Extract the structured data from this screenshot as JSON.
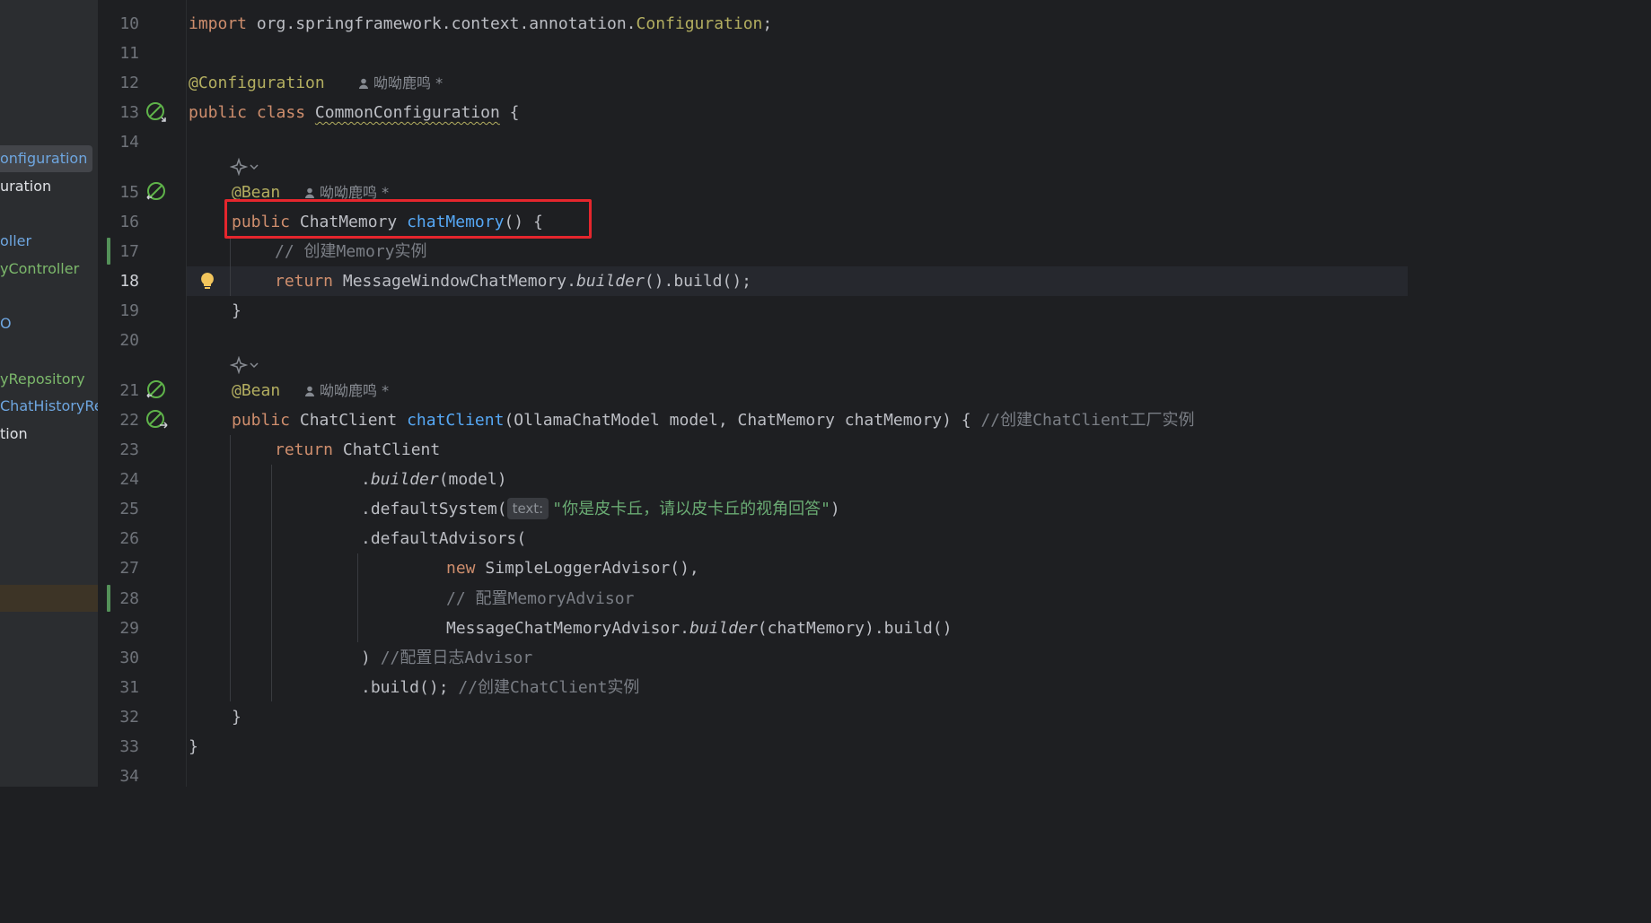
{
  "sidebar": {
    "items": [
      {
        "label": "onfiguration",
        "color": "#6ea6e0",
        "selected": true
      },
      {
        "label": "uration",
        "color": "#dfe1e5"
      },
      {
        "label": "oller",
        "color": "#6ea6e0"
      },
      {
        "label": "yController",
        "color": "#7cb86b"
      },
      {
        "label": "O",
        "color": "#6ea6e0"
      },
      {
        "label": "yRepository",
        "color": "#7cb86b"
      },
      {
        "label": "ChatHistoryRep",
        "color": "#6ea6e0"
      },
      {
        "label": "tion",
        "color": "#dfe1e5"
      }
    ]
  },
  "gutter": {
    "line_numbers": [
      "10",
      "11",
      "12",
      "13",
      "14",
      "15",
      "16",
      "17",
      "18",
      "19",
      "20",
      "21",
      "22",
      "23",
      "24",
      "25",
      "26",
      "27",
      "28",
      "29",
      "30",
      "31",
      "32",
      "33",
      "34"
    ],
    "current_line": "18"
  },
  "code": {
    "l10": {
      "kw": "import",
      "pkg": " org.springframework.context.annotation.",
      "cls": "Configuration",
      ";": ";"
    },
    "l12": {
      "ann": "@Configuration",
      "author": "呦呦鹿鸣 *"
    },
    "l13": {
      "kw": "public class ",
      "name": "CommonConfiguration",
      " ob": " {"
    },
    "l15": {
      "ann": "@Bean",
      "author": "呦呦鹿鸣 *"
    },
    "l16": {
      "kw": "public ",
      "type": "ChatMemory ",
      "fn": "chatMemory",
      "rest": "() {"
    },
    "l17": {
      "comment": "// 创建Memory实例"
    },
    "l18": {
      "kw": "return ",
      "cls": "MessageWindowChatMemory.",
      "it": "builder",
      "rest": "().build();"
    },
    "l19": {
      "text": "}"
    },
    "l21": {
      "ann": "@Bean",
      "author": "呦呦鹿鸣 *"
    },
    "l22": {
      "kw": "public ",
      "type": "ChatClient ",
      "fn": "chatClient",
      "rest": "(OllamaChatModel model, ChatMemory chatMemory) { ",
      "comment": "//创建ChatClient工厂实例"
    },
    "l23": {
      "kw": "return ",
      "rest": "ChatClient"
    },
    "l24": {
      "pre": ".",
      "it": "builder",
      "rest": "(model)"
    },
    "l25": {
      "pre": ".defaultSystem(",
      "hint": "text:",
      "str": "\"你是皮卡丘，请以皮卡丘的视角回答\"",
      "rest": ")"
    },
    "l26": {
      "text": ".defaultAdvisors("
    },
    "l27": {
      "kw": "new ",
      "rest": "SimpleLoggerAdvisor(),"
    },
    "l28": {
      "comment": "// 配置MemoryAdvisor"
    },
    "l29": {
      "pre": "MessageChatMemoryAdvisor.",
      "it": "builder",
      "rest": "(chatMemory).build()"
    },
    "l30": {
      "pre": ") ",
      "comment": "//配置日志Advisor"
    },
    "l31": {
      "pre": ".build(); ",
      "comment": "//创建ChatClient实例"
    },
    "l32": {
      "text": "}"
    },
    "l33": {
      "text": "}"
    }
  },
  "icons": {
    "bean_gutter": "spring-bean-icon",
    "bulb": "lightbulb-icon",
    "ai": "ai-assistant-icon"
  },
  "colors": {
    "highlight_box": "#e5262d",
    "background": "#1e1f22"
  }
}
